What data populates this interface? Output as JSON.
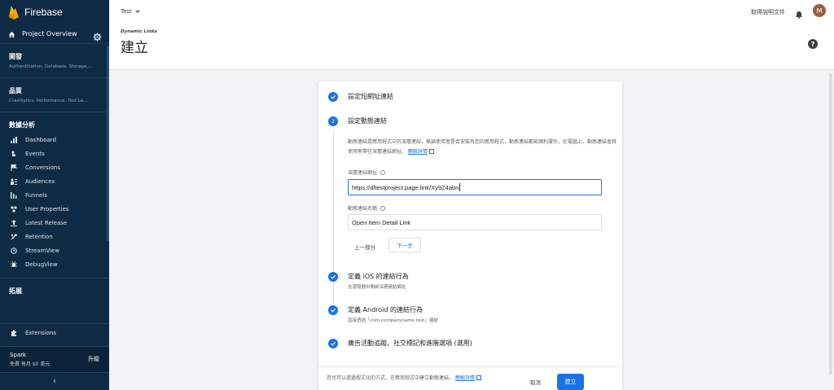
{
  "brand": {
    "name": "Firebase"
  },
  "sidebar": {
    "overview_label": "Project Overview",
    "develop": {
      "title": "開發",
      "subtitle": "Authentication, Database, Storage,..."
    },
    "quality": {
      "title": "品質",
      "subtitle": "Crashlytics, Performance, Test La..."
    },
    "analytics": {
      "title": "數據分析",
      "items": [
        {
          "label": "Dashboard",
          "icon": "bar-chart-icon"
        },
        {
          "label": "Events",
          "icon": "touch-icon"
        },
        {
          "label": "Conversions",
          "icon": "flag-icon"
        },
        {
          "label": "Audiences",
          "icon": "people-icon"
        },
        {
          "label": "Funnels",
          "icon": "funnel-icon"
        },
        {
          "label": "User Properties",
          "icon": "user-properties-icon"
        },
        {
          "label": "Latest Release",
          "icon": "release-icon"
        },
        {
          "label": "Retention",
          "icon": "retention-icon"
        },
        {
          "label": "StreamView",
          "icon": "clock-icon"
        },
        {
          "label": "DebugView",
          "icon": "debug-icon"
        }
      ]
    },
    "grow": {
      "title": "拓展"
    },
    "extensions_label": "Extensions",
    "plan": {
      "name": "Spark",
      "price": "免費 每月 $0 美元",
      "upgrade_label": "升級"
    },
    "collapse_glyph": "‹"
  },
  "header": {
    "project_name": "Test",
    "docs_label": "取得說明文件",
    "avatar_initial": "M",
    "product_label": "Dynamic Links",
    "page_title": "建立",
    "help_glyph": "?"
  },
  "wizard": {
    "steps": [
      {
        "title": "設定短網址連結",
        "state": "done"
      },
      {
        "title": "設定動態連結",
        "state": "active",
        "number": "2"
      },
      {
        "title": "定義 iOS 的連結行為",
        "subtitle": "在瀏覽器中開啟深層連結網址",
        "state": "done"
      },
      {
        "title": "定義 Android 的連結行為",
        "subtitle": "直接透過「com.companyname.test」連結",
        "state": "done"
      },
      {
        "title": "廣告活動追蹤、社交標記和進階選項 (選用)",
        "state": "done"
      }
    ],
    "description": "動態連結是應用程式中的深層連結，無論使用者是否安裝有您的應用程式，動態連結都能順利運作。在電腦上，動態連結會將使用者帶往深層連結網址。",
    "learn_more_label": "瞭解詳情",
    "deep_link_label": "深層連結網址",
    "deep_link_value": "https://dltestproject.page.link/Xy9Z4abn",
    "link_name_label": "動態連結名稱",
    "link_name_value": "Open Item Detail Link",
    "prev_label": "上一部分",
    "next_label": "下一步",
    "footer_note": "您也可以透過程式化的方式，在應用程式中建立動態連結。",
    "footer_learn_more": "瞭解詳情",
    "cancel_label": "取消",
    "create_label": "建立"
  },
  "colors": {
    "sidebar_bg": "#0f2a44",
    "accent": "#1a73e8",
    "brand_flame": "#ffa000"
  }
}
